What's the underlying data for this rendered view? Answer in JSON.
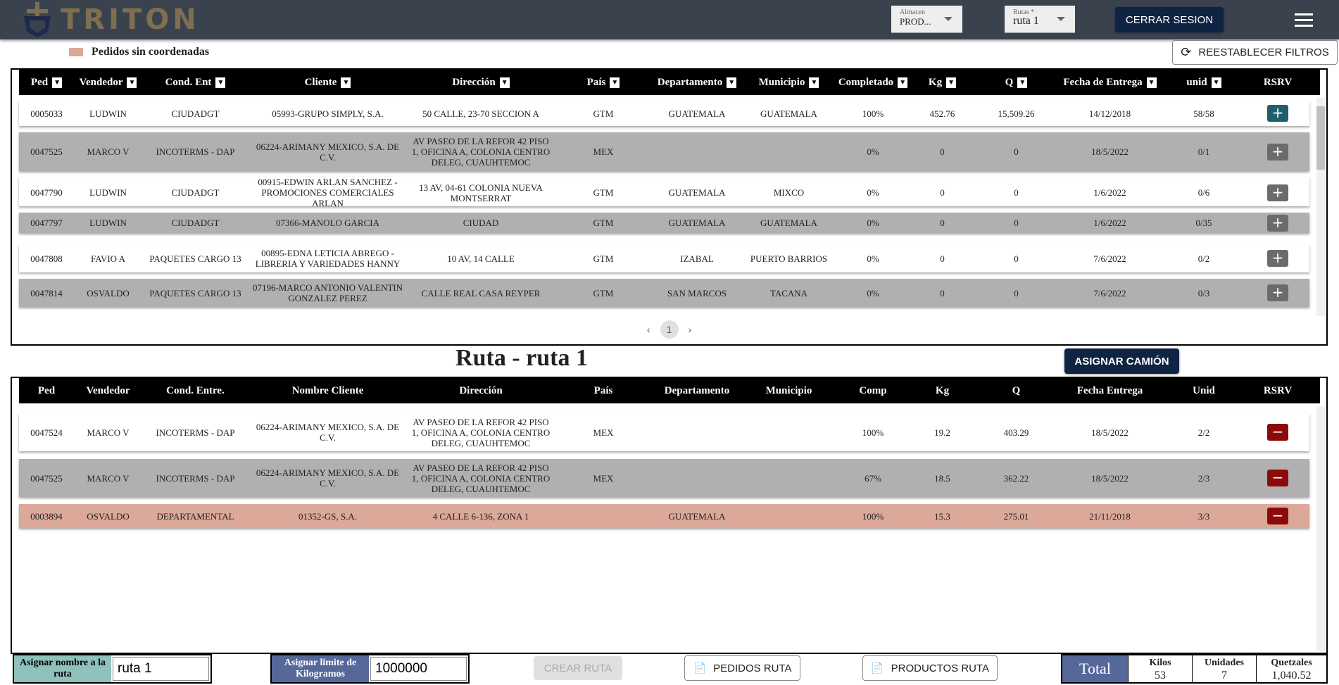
{
  "header": {
    "brand": "TRITON",
    "almacen_label": "Almacen",
    "almacen_value": "PROD...",
    "rutas_label": "Rutas *",
    "rutas_value": "ruta 1",
    "logout": "CERRAR SESION"
  },
  "legend": "Pedidos sin coordenadas",
  "reset_filters": "REESTABLECER FILTROS",
  "table1": {
    "columns": [
      "Ped",
      "Vendedor",
      "Cond. Ent",
      "Cliente",
      "Dirección",
      "País",
      "Departamento",
      "Municipio",
      "Completado",
      "Kg",
      "Q",
      "Fecha de Entrega",
      "unid",
      "RSRV"
    ],
    "rows": [
      [
        "0005033",
        "LUDWIN",
        "CIUDADGT",
        "05993-GRUPO SIMPLY, S.A.",
        "50 CALLE, 23-70 SECCION A",
        "GTM",
        "GUATEMALA",
        "GUATEMALA",
        "100%",
        "452.76",
        "15,509.26",
        "14/12/2018",
        "58/58"
      ],
      [
        "0047525",
        "MARCO V",
        "INCOTERMS - DAP",
        "06224-ARIMANY MEXICO, S.A. DE C.V.",
        "AV PASEO DE LA REFOR 42 PISO 1, OFICINA A, COLONIA CENTRO DELEG, CUAUHTEMOC",
        "MEX",
        "",
        "",
        "0%",
        "0",
        "0",
        "18/5/2022",
        "0/1"
      ],
      [
        "0047790",
        "LUDWIN",
        "CIUDADGT",
        "00915-EDWIN ARLAN SANCHEZ - PROMOCIONES COMERCIALES ARLAN",
        "13 AV, 04-61 COLONIA NUEVA MONTSERRAT",
        "GTM",
        "GUATEMALA",
        "MIXCO",
        "0%",
        "0",
        "0",
        "1/6/2022",
        "0/6"
      ],
      [
        "0047797",
        "LUDWIN",
        "CIUDADGT",
        "07366-MANOLO GARCIA",
        "CIUDAD",
        "GTM",
        "GUATEMALA",
        "GUATEMALA",
        "0%",
        "0",
        "0",
        "1/6/2022",
        "0/35"
      ],
      [
        "0047808",
        "FAVIO A",
        "PAQUETES CARGO 13",
        "00895-EDNA LETICIA ABREGO - LIBRERIA Y VARIEDADES HANNY",
        "10 AV, 14 CALLE",
        "GTM",
        "IZABAL",
        "PUERTO BARRIOS",
        "0%",
        "0",
        "0",
        "7/6/2022",
        "0/2"
      ],
      [
        "0047814",
        "OSVALDO",
        "PAQUETES CARGO 13",
        "07196-MARCO ANTONIO VALENTIN GONZALEZ PEREZ",
        "CALLE REAL CASA REYPER",
        "GTM",
        "SAN MARCOS",
        "TACANA",
        "0%",
        "0",
        "0",
        "7/6/2022",
        "0/3"
      ]
    ]
  },
  "pagination": {
    "current": "1"
  },
  "route_title": "Ruta - ruta 1",
  "assign_truck": "ASIGNAR CAMIÓN",
  "table2": {
    "columns": [
      "Ped",
      "Vendedor",
      "Cond. Entre.",
      "Nombre Cliente",
      "Dirección",
      "País",
      "Departamento",
      "Municipio",
      "Comp",
      "Kg",
      "Q",
      "Fecha Entrega",
      "Unid",
      "RSRV"
    ],
    "rows": [
      [
        "0047524",
        "MARCO V",
        "INCOTERMS - DAP",
        "06224-ARIMANY MEXICO, S.A. DE C.V.",
        "AV PASEO DE LA REFOR 42 PISO 1, OFICINA A, COLONIA CENTRO DELEG, CUAUHTEMOC",
        "MEX",
        "",
        "",
        "100%",
        "19.2",
        "403.29",
        "18/5/2022",
        "2/2"
      ],
      [
        "0047525",
        "MARCO V",
        "INCOTERMS - DAP",
        "06224-ARIMANY MEXICO, S.A. DE C.V.",
        "AV PASEO DE LA REFOR 42 PISO 1, OFICINA A, COLONIA CENTRO DELEG, CUAUHTEMOC",
        "MEX",
        "",
        "",
        "67%",
        "18.5",
        "362.22",
        "18/5/2022",
        "2/3"
      ],
      [
        "0003894",
        "OSVALDO",
        "DEPARTAMENTAL",
        "01352-GS, S.A.",
        "4 CALLE 6-136, ZONA 1",
        "",
        "GUATEMALA",
        "",
        "100%",
        "15.3",
        "275.01",
        "21/11/2018",
        "3/3"
      ]
    ]
  },
  "footer": {
    "name_label": "Asignar nombre a la ruta",
    "name_value": "ruta 1",
    "limit_label": "Asignar limite de Kilogramos",
    "limit_value": "1000000",
    "create": "CREAR RUTA",
    "orders": "PEDIDOS RUTA",
    "products": "PRODUCTOS RUTA",
    "total": "Total",
    "kilos_label": "Kilos",
    "kilos": "53",
    "units_label": "Unidades",
    "units": "7",
    "q_label": "Quetzales",
    "q": "1,040.52"
  }
}
